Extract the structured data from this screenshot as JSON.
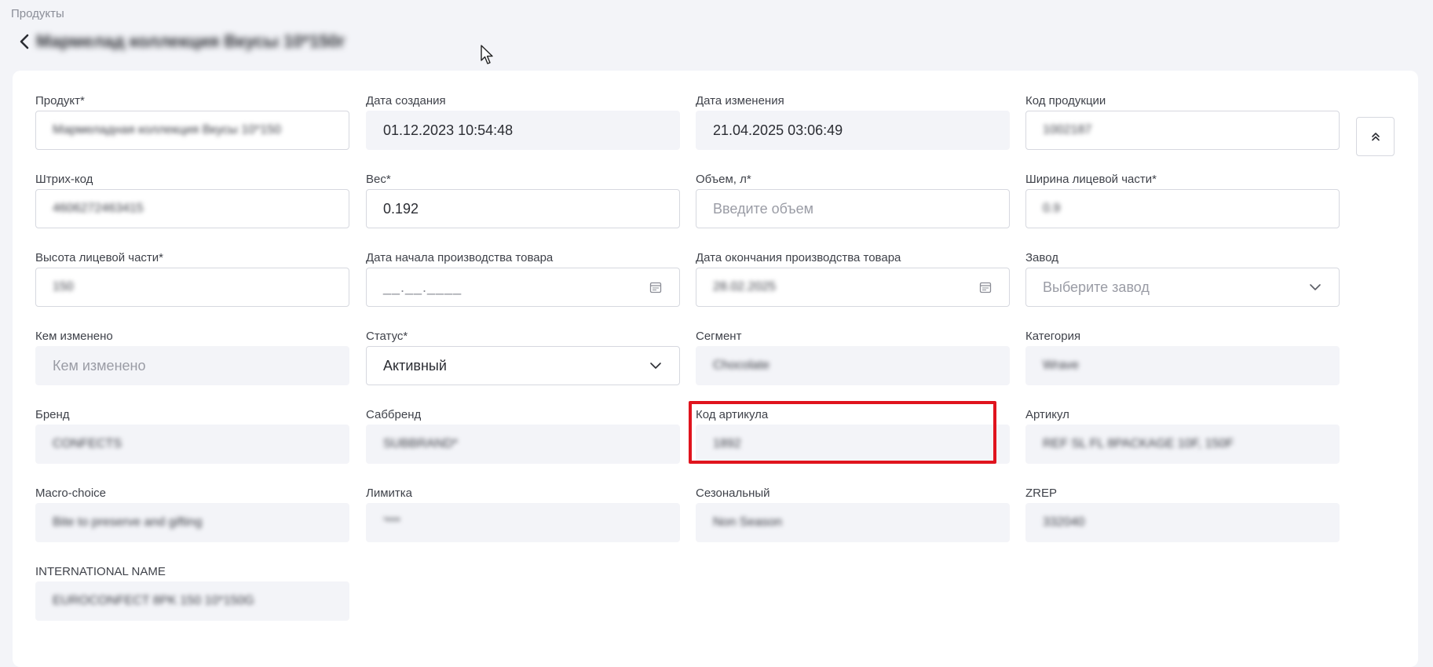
{
  "breadcrumb": "Продукты",
  "page_title": "Мармелад коллекция Вкусы 10*150г",
  "fields": {
    "product": {
      "label": "Продукт*",
      "value": "Мармеладная коллекция Вкусы 10*150"
    },
    "created_date": {
      "label": "Дата создания",
      "value": "01.12.2023 10:54:48"
    },
    "modified_date": {
      "label": "Дата изменения",
      "value": "21.04.2025 03:06:49"
    },
    "product_code": {
      "label": "Код продукции",
      "value": "1002187"
    },
    "barcode": {
      "label": "Штрих-код",
      "value": "4606272463415"
    },
    "weight": {
      "label": "Вес*",
      "value": "0.192"
    },
    "volume": {
      "label": "Объем, л*",
      "placeholder": "Введите объем"
    },
    "face_width": {
      "label": "Ширина лицевой части*",
      "value": "0.9"
    },
    "face_height": {
      "label": "Высота лицевой части*",
      "value": "150"
    },
    "prod_start": {
      "label": "Дата начала производства товара",
      "value": "__.__.____"
    },
    "prod_end": {
      "label": "Дата окончания производства товара",
      "value": "28.02.2025"
    },
    "plant": {
      "label": "Завод",
      "placeholder": "Выберите завод"
    },
    "changed_by": {
      "label": "Кем изменено",
      "placeholder": "Кем изменено"
    },
    "status": {
      "label": "Статус*",
      "value": "Активный"
    },
    "segment": {
      "label": "Сегмент",
      "value": "Chocolate"
    },
    "category": {
      "label": "Категория",
      "value": "Wrave"
    },
    "brand": {
      "label": "Бренд",
      "value": "CONFECTS"
    },
    "subbrand": {
      "label": "Саббренд",
      "value": "SUBBRAND*"
    },
    "article_code": {
      "label": "Код артикула",
      "value": "1892"
    },
    "article": {
      "label": "Артикул",
      "value": "REF SL FL 8PACKAGE 10F, 150F"
    },
    "macro_choice": {
      "label": "Macro-choice",
      "value": "Bite to preserve and gifting"
    },
    "limitka": {
      "label": "Лимитка",
      "value": "'***"
    },
    "seasonal": {
      "label": "Сезональный",
      "value": "Non Season"
    },
    "zrep": {
      "label": "ZREP",
      "value": "332040"
    },
    "international_name": {
      "label": "INTERNATIONAL NAME",
      "value": "EUROCONFECT 8PK 150 10*150G"
    }
  },
  "icons": {
    "back": "chevron-left-icon",
    "calendar": "calendar-icon",
    "dropdown": "chevron-down-icon",
    "collapse": "double-chevron-up-icon",
    "cursor": "mouse-cursor-icon"
  },
  "colors": {
    "highlight": "#e0141e",
    "readonly_bg": "#f3f4f8",
    "border": "#d6d8df"
  }
}
